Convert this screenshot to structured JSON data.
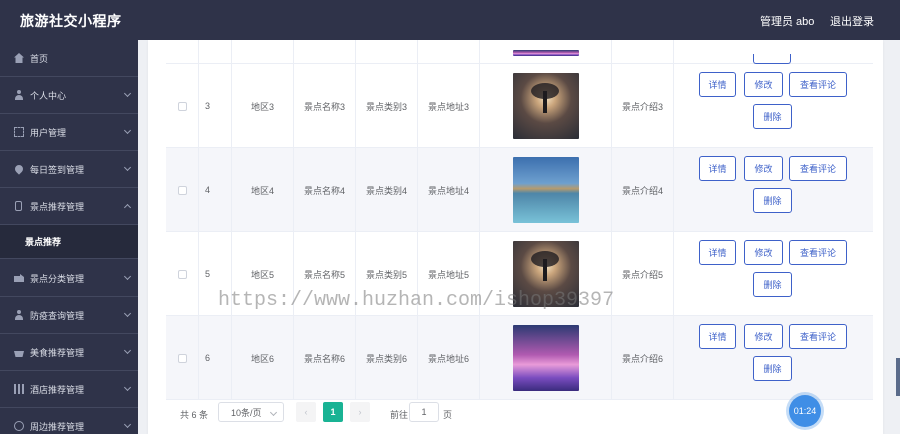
{
  "header": {
    "app_title": "旅游社交小程序",
    "admin_label": "管理员 abo",
    "logout_label": "退出登录"
  },
  "sidebar": {
    "items": [
      {
        "label": "首页",
        "icon": "home-icon"
      },
      {
        "label": "个人中心",
        "icon": "user-icon"
      },
      {
        "label": "用户管理",
        "icon": "frame-icon"
      },
      {
        "label": "每日签到管理",
        "icon": "pin-icon"
      },
      {
        "label": "景点推荐管理",
        "icon": "phone-icon"
      },
      {
        "label": "景点推荐",
        "icon": ""
      },
      {
        "label": "景点分类管理",
        "icon": "truck-icon"
      },
      {
        "label": "防疫查询管理",
        "icon": "user-icon"
      },
      {
        "label": "美食推荐管理",
        "icon": "bowl-icon"
      },
      {
        "label": "酒店推荐管理",
        "icon": "grid-icon"
      },
      {
        "label": "周边推荐管理",
        "icon": "circle-icon"
      }
    ]
  },
  "table": {
    "rows": [
      {
        "index": "3",
        "region": "地区3",
        "name": "景点名称3",
        "category": "景点类别3",
        "address": "景点地址3",
        "image": "tree",
        "intro": "景点介绍3"
      },
      {
        "index": "4",
        "region": "地区4",
        "name": "景点名称4",
        "category": "景点类别4",
        "address": "景点地址4",
        "image": "lake",
        "intro": "景点介绍4"
      },
      {
        "index": "5",
        "region": "地区5",
        "name": "景点名称5",
        "category": "景点类别5",
        "address": "景点地址5",
        "image": "tree",
        "intro": "景点介绍5"
      },
      {
        "index": "6",
        "region": "地区6",
        "name": "景点名称6",
        "category": "景点类别6",
        "address": "景点地址6",
        "image": "palm",
        "intro": "景点介绍6"
      }
    ],
    "actions": {
      "detail": "详情",
      "edit": "修改",
      "comments": "查看评论",
      "delete": "删除"
    }
  },
  "pagination": {
    "total": "共 6 条",
    "page_size": "10条/页",
    "current_page": "1",
    "goto_label": "前往",
    "goto_value": "1",
    "page_unit": "页"
  },
  "watermark": "https://www.huzhan.com/ishop39397",
  "timer": "01:24",
  "colors": {
    "sidebar_bg": "#2f3349",
    "primary": "#3e61c9",
    "active_page": "#19b394"
  }
}
